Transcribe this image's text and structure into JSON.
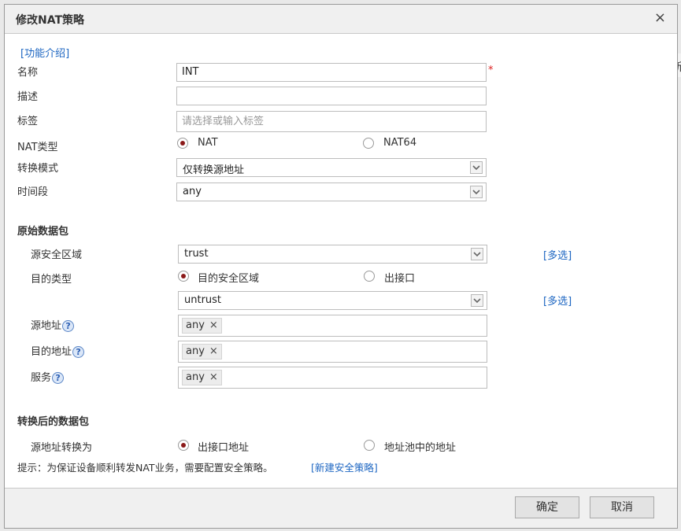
{
  "background": {
    "cut_text": "新"
  },
  "dialog": {
    "title": "修改NAT策略",
    "close_glyph": "×",
    "help_link": "[功能介绍]"
  },
  "form": {
    "name": {
      "label": "名称",
      "value": "INT",
      "required_mark": "*"
    },
    "description": {
      "label": "描述",
      "value": ""
    },
    "tags": {
      "label": "标签",
      "placeholder": "请选择或输入标签"
    },
    "nat_type": {
      "label": "NAT类型",
      "options": [
        "NAT",
        "NAT64"
      ],
      "selected": "NAT"
    },
    "convert_mode": {
      "label": "转换模式",
      "value": "仅转换源地址"
    },
    "time_range": {
      "label": "时间段",
      "value": "any"
    }
  },
  "original_packet": {
    "section_title": "原始数据包",
    "source_zone": {
      "label": "源安全区域",
      "value": "trust",
      "multi_link": "[多选]"
    },
    "dest_type": {
      "label": "目的类型",
      "options": [
        "目的安全区域",
        "出接口"
      ],
      "selected": "目的安全区域"
    },
    "dest_zone": {
      "value": "untrust",
      "multi_link": "[多选]"
    },
    "source_addr": {
      "label": "源地址",
      "tag": "any"
    },
    "dest_addr": {
      "label": "目的地址",
      "tag": "any"
    },
    "service": {
      "label": "服务",
      "tag": "any"
    },
    "help_glyph": "?",
    "tag_remove_glyph": "×"
  },
  "converted_packet": {
    "section_title": "转换后的数据包",
    "source_convert": {
      "label": "源地址转换为",
      "options": [
        "出接口地址",
        "地址池中的地址"
      ],
      "selected": "出接口地址"
    }
  },
  "hint": {
    "text": "提示：为保证设备顺利转发NAT业务，需要配置安全策略。",
    "link": "[新建安全策略]"
  },
  "footer": {
    "ok_label": "确定",
    "cancel_label": "取消"
  },
  "colors": {
    "link": "#1d66c2",
    "radio_selected": "#8b1a1a",
    "required": "#d22222"
  }
}
